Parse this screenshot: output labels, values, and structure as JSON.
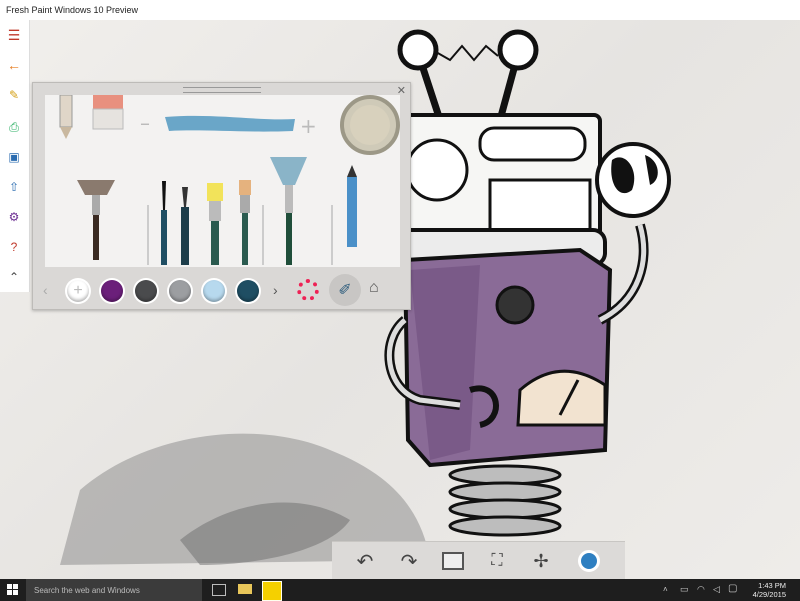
{
  "window": {
    "title": "Fresh Paint Windows 10 Preview"
  },
  "sidebar": {
    "items": [
      {
        "name": "menu-icon",
        "glyph": "☰",
        "color": "#c0392b"
      },
      {
        "name": "back-icon",
        "glyph": "←",
        "color": "#e67e22"
      },
      {
        "name": "pencil-icon",
        "glyph": "✎",
        "color": "#d4a017"
      },
      {
        "name": "print-icon",
        "glyph": "⎙",
        "color": "#27ae60"
      },
      {
        "name": "save-icon",
        "glyph": "▣",
        "color": "#2b6cb0"
      },
      {
        "name": "share-icon",
        "glyph": "⇧",
        "color": "#2b6cb0"
      },
      {
        "name": "settings-icon",
        "glyph": "⚙",
        "color": "#6b2c91"
      },
      {
        "name": "help-icon",
        "glyph": "?",
        "color": "#c0392b"
      },
      {
        "name": "collapse-icon",
        "glyph": "⌃",
        "color": "#444"
      }
    ]
  },
  "palette": {
    "swatches": [
      "#ffffff",
      "#6b1f7a",
      "#4a4b4d",
      "#9c9ea1",
      "#b7d9ee",
      "#1f4e63"
    ],
    "colors": {
      "accent": "#2e7fc1"
    }
  },
  "bottom_bar": {
    "buttons": [
      "undo-icon",
      "redo-icon",
      "canvas-icon",
      "fit-screen-icon",
      "fan-icon",
      "dryer-icon"
    ]
  },
  "taskbar": {
    "search_placeholder": "Search the web and Windows",
    "time": "1:43 PM",
    "date": "4/29/2015"
  }
}
